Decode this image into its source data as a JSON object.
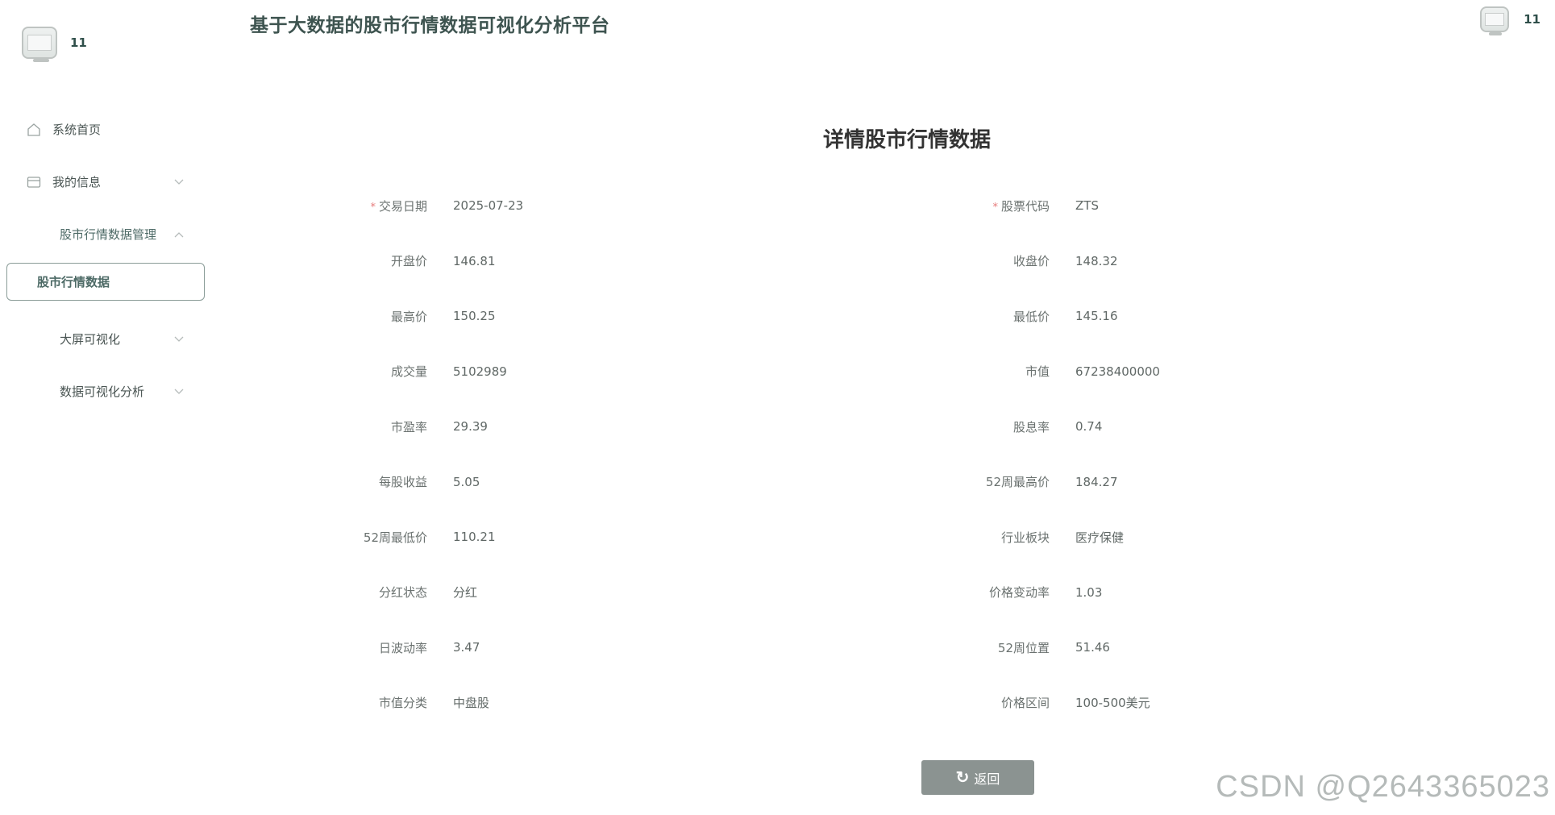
{
  "user": {
    "name": "11"
  },
  "header": {
    "title": "基于大数据的股市行情数据可视化分析平台",
    "user_name": "11"
  },
  "sidebar": {
    "items": [
      {
        "label": "系统首页",
        "icon": "home-icon"
      },
      {
        "label": "我的信息",
        "icon": "card-icon",
        "chevron": "chevron-down"
      },
      {
        "label": "股市行情数据管理",
        "icon": "grid-icon",
        "chevron": "chevron-up"
      },
      {
        "label": "大屏可视化",
        "icon": "grid-icon",
        "chevron": "chevron-down"
      },
      {
        "label": "数据可视化分析",
        "icon": "grid-icon",
        "chevron": "chevron-down"
      }
    ],
    "active_sub": "股市行情数据"
  },
  "detail": {
    "title": "详情股市行情数据",
    "left": [
      {
        "label": "交易日期",
        "value": "2025-07-23",
        "required": true
      },
      {
        "label": "开盘价",
        "value": "146.81"
      },
      {
        "label": "最高价",
        "value": "150.25"
      },
      {
        "label": "成交量",
        "value": "5102989"
      },
      {
        "label": "市盈率",
        "value": "29.39"
      },
      {
        "label": "每股收益",
        "value": "5.05"
      },
      {
        "label": "52周最低价",
        "value": "110.21"
      },
      {
        "label": "分红状态",
        "value": "分红"
      },
      {
        "label": "日波动率",
        "value": "3.47"
      },
      {
        "label": "市值分类",
        "value": "中盘股"
      }
    ],
    "right": [
      {
        "label": "股票代码",
        "value": "ZTS",
        "required": true
      },
      {
        "label": "收盘价",
        "value": "148.32"
      },
      {
        "label": "最低价",
        "value": "145.16"
      },
      {
        "label": "市值",
        "value": "67238400000"
      },
      {
        "label": "股息率",
        "value": "0.74"
      },
      {
        "label": "52周最高价",
        "value": "184.27"
      },
      {
        "label": "行业板块",
        "value": "医疗保健"
      },
      {
        "label": "价格变动率",
        "value": "1.03"
      },
      {
        "label": "52周位置",
        "value": "51.46"
      },
      {
        "label": "价格区间",
        "value": "100-500美元"
      }
    ],
    "required_mark": "*",
    "back_label": "返回"
  },
  "watermark": "CSDN @Q2643365023",
  "colors": {
    "accent": "#4d6a66",
    "button": "#8b9391",
    "required": "#e67a7a"
  }
}
